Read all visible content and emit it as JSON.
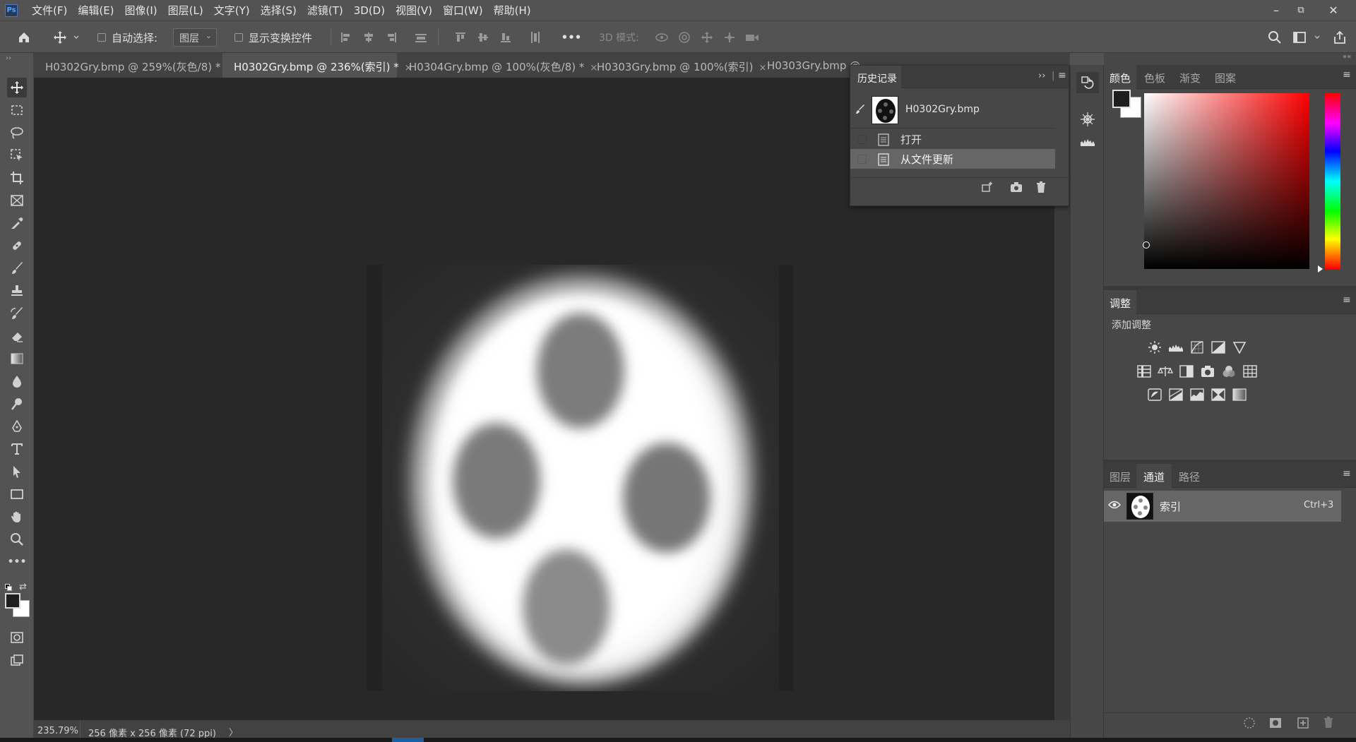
{
  "app": {
    "logo": "Ps"
  },
  "menu": [
    "文件(F)",
    "编辑(E)",
    "图像(I)",
    "图层(L)",
    "文字(Y)",
    "选择(S)",
    "滤镜(T)",
    "3D(D)",
    "视图(V)",
    "窗口(W)",
    "帮助(H)"
  ],
  "window_controls": {
    "minimize": "–",
    "restore": "⧉",
    "close": "✕"
  },
  "options": {
    "auto_select_label": "自动选择:",
    "auto_select_value": "图层",
    "show_transform_label": "显示变换控件",
    "more": "•••",
    "mode_3d_label": "3D 模式:"
  },
  "tabs": [
    {
      "label": "H0302Gry.bmp @ 259%(灰色/8) *",
      "active": false
    },
    {
      "label": "H0302Gry.bmp @ 236%(索引) *",
      "active": true
    },
    {
      "label": "H0304Gry.bmp @ 100%(灰色/8) *",
      "active": false
    },
    {
      "label": "H0303Gry.bmp @ 100%(索引)",
      "active": false
    },
    {
      "label": "H0303Gry.bmp @",
      "active": false
    }
  ],
  "tab_close": "×",
  "history": {
    "title": "历史记录",
    "snapshot": "H0302Gry.bmp",
    "steps": [
      "打开",
      "从文件更新"
    ]
  },
  "color_panel": {
    "tabs": [
      "颜色",
      "色板",
      "渐变",
      "图案"
    ],
    "hue_color": "#ff0000",
    "foreground": "#1e1e1e",
    "background": "#ffffff"
  },
  "adjustments": {
    "tab": "调整",
    "add_label": "添加调整"
  },
  "channels": {
    "tabs": [
      "图层",
      "通道",
      "路径"
    ],
    "row": {
      "name": "索引",
      "shortcut": "Ctrl+3"
    }
  },
  "status": {
    "zoom": "235.79%",
    "doc_info": "256 像素 x 256 像素 (72 ppi)",
    "arrow": "〉"
  }
}
